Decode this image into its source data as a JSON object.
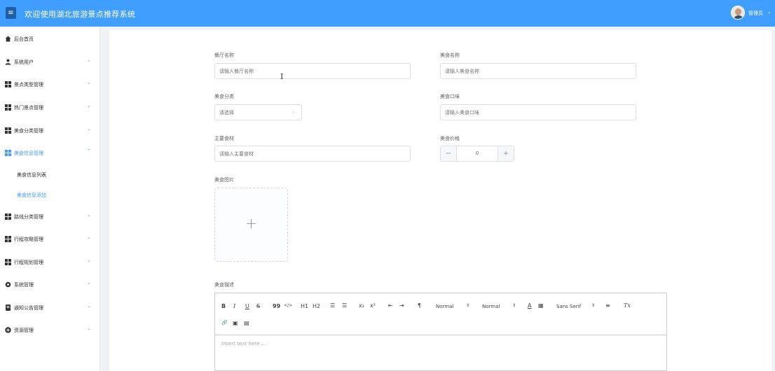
{
  "header": {
    "menu_icon": "≡",
    "title": "欢迎使用湖北旅游景点推荐系统",
    "user_name": "管理员",
    "user_caret": "⌄"
  },
  "sidebar": {
    "items": [
      {
        "label": "后台首页",
        "icon": "home-icon"
      },
      {
        "label": "系统用户",
        "icon": "user-icon",
        "arrow": "⌄"
      },
      {
        "label": "景点类型管理",
        "icon": "grid-icon",
        "arrow": "⌄"
      },
      {
        "label": "热门景点管理",
        "icon": "grid-icon",
        "arrow": "⌄"
      },
      {
        "label": "美食分类管理",
        "icon": "grid-icon",
        "arrow": "⌄"
      },
      {
        "label": "美食信息管理",
        "icon": "grid-icon",
        "arrow": "⌃"
      },
      {
        "label": "路线分类管理",
        "icon": "grid-icon",
        "arrow": "⌄"
      },
      {
        "label": "行程攻略管理",
        "icon": "grid-icon",
        "arrow": "⌄"
      },
      {
        "label": "行程规划管理",
        "icon": "grid-icon",
        "arrow": "⌄"
      },
      {
        "label": "系统管理",
        "icon": "gear-icon",
        "arrow": "⌄"
      },
      {
        "label": "通知公告管理",
        "icon": "document-icon",
        "arrow": "⌄"
      },
      {
        "label": "资源管理",
        "icon": "plus-circle-icon",
        "arrow": "⌄"
      }
    ],
    "sub_items": [
      {
        "label": "美食信息列表"
      },
      {
        "label": "美食信息添加"
      }
    ]
  },
  "form": {
    "restaurant": {
      "label": "餐厅名称",
      "placeholder": "请输入餐厅名称"
    },
    "food_name": {
      "label": "美食名称",
      "placeholder": "请输入美食名称"
    },
    "category": {
      "label": "美食分类",
      "placeholder": "请选择",
      "arrow": "⌄"
    },
    "flavor": {
      "label": "美食口味",
      "placeholder": "请输入美食口味"
    },
    "ingredients": {
      "label": "主要食材",
      "placeholder": "请输入主要食材"
    },
    "price": {
      "label": "美食价格",
      "value": "0",
      "minus": "−",
      "plus": "+"
    },
    "image": {
      "label": "美食图片",
      "plus": "+"
    },
    "description": {
      "label": "美食描述",
      "placeholder": "Insert text here ..."
    }
  },
  "editor_toolbar": {
    "bold": "B",
    "italic": "I",
    "underline": "U",
    "strike": "S",
    "quote": "99",
    "code": "</>",
    "h1": "H1",
    "h2": "H2",
    "ol": "☰",
    "ul": "☰",
    "sub": "x₂",
    "sup": "x²",
    "outdent": "⇤",
    "indent": "⇥",
    "direction": "¶",
    "size_value": "Normal",
    "header_value": "Normal",
    "font_value": "Sans Serif",
    "align": "≡",
    "clean": "Tx",
    "color": "A",
    "background": "▦",
    "link": "🔗",
    "image": "▣",
    "video": "▤"
  },
  "colors": {
    "brand": "#409eff",
    "border": "#dcdfe6",
    "text": "#606266"
  }
}
